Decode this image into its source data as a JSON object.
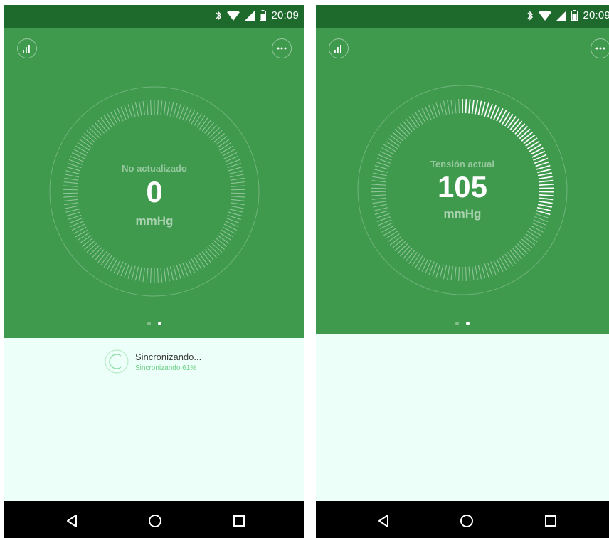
{
  "status_bar": {
    "time": "20:09"
  },
  "screens": [
    {
      "gauge": {
        "label": "No actualizado",
        "value": "0",
        "unit": "mmHg",
        "level_fraction": 0
      },
      "page_dots": {
        "count": 2,
        "active_index": 1
      },
      "sync": {
        "title": "Sincronizando...",
        "subtitle": "Sincronizando 61%"
      }
    },
    {
      "gauge": {
        "label": "Tensión actual",
        "value": "105",
        "unit": "mmHg",
        "level_fraction": 0.3
      },
      "page_dots": {
        "count": 2,
        "active_index": 1
      }
    }
  ],
  "icons": {
    "stats": "bar-chart-icon",
    "more": "more-options-icon",
    "back": "back-triangle-icon",
    "home": "home-circle-icon",
    "recent": "recent-apps-square-icon",
    "sync": "sync-spinner-icon"
  },
  "colors": {
    "green": "#3f9a4e",
    "dark_green": "#1e6a2c",
    "light_bg": "#ecfff8",
    "accent": "#6ccf87"
  }
}
